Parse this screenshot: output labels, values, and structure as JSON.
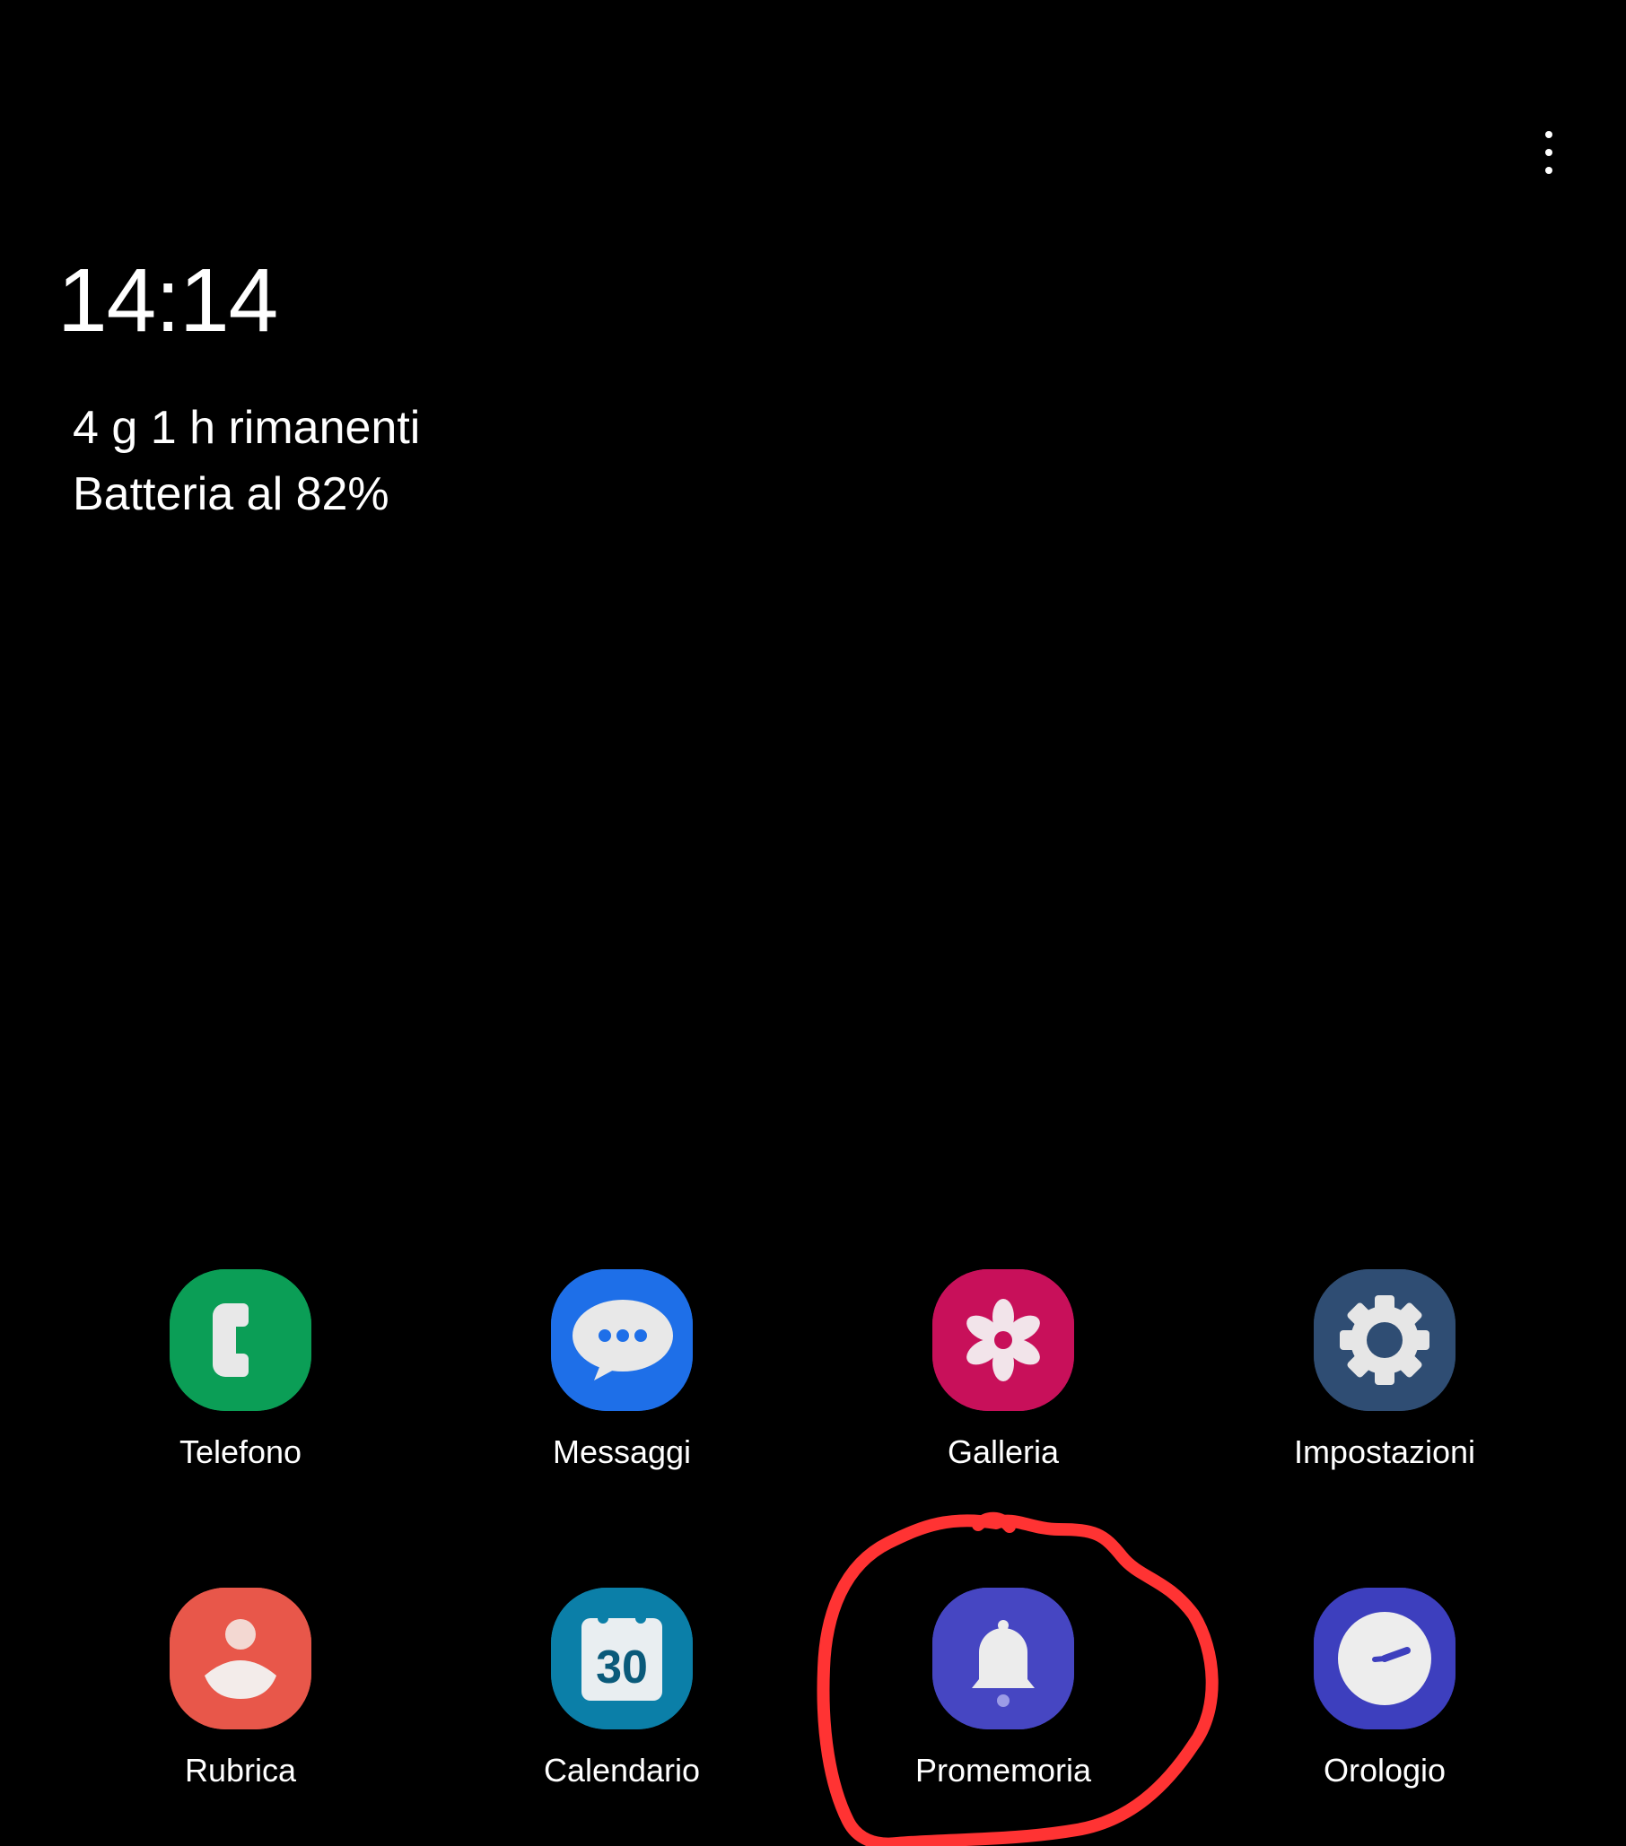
{
  "header": {
    "menu_icon": "more-vert-icon"
  },
  "clock": {
    "time": "14:14"
  },
  "battery": {
    "remaining": "4 g 1 h rimanenti",
    "level": "Batteria al 82%"
  },
  "apps": [
    {
      "label": "Telefono",
      "icon": "phone-icon",
      "color": "#0B9E56"
    },
    {
      "label": "Messaggi",
      "icon": "message-bubble-icon",
      "color": "#1E6FE8"
    },
    {
      "label": "Galleria",
      "icon": "flower-icon",
      "color": "#C8105A"
    },
    {
      "label": "Impostazioni",
      "icon": "gear-icon",
      "color": "#2F4D73"
    },
    {
      "label": "Rubrica",
      "icon": "person-icon",
      "color": "#E8574A"
    },
    {
      "label": "Calendario",
      "icon": "calendar-icon",
      "color": "#0B7FA8",
      "badge": "30"
    },
    {
      "label": "Promemoria",
      "icon": "bell-icon",
      "color": "#4646C2"
    },
    {
      "label": "Orologio",
      "icon": "clock-icon",
      "color": "#3D3FBE"
    }
  ],
  "annotation": {
    "color": "#FF3333",
    "target": "Promemoria"
  }
}
